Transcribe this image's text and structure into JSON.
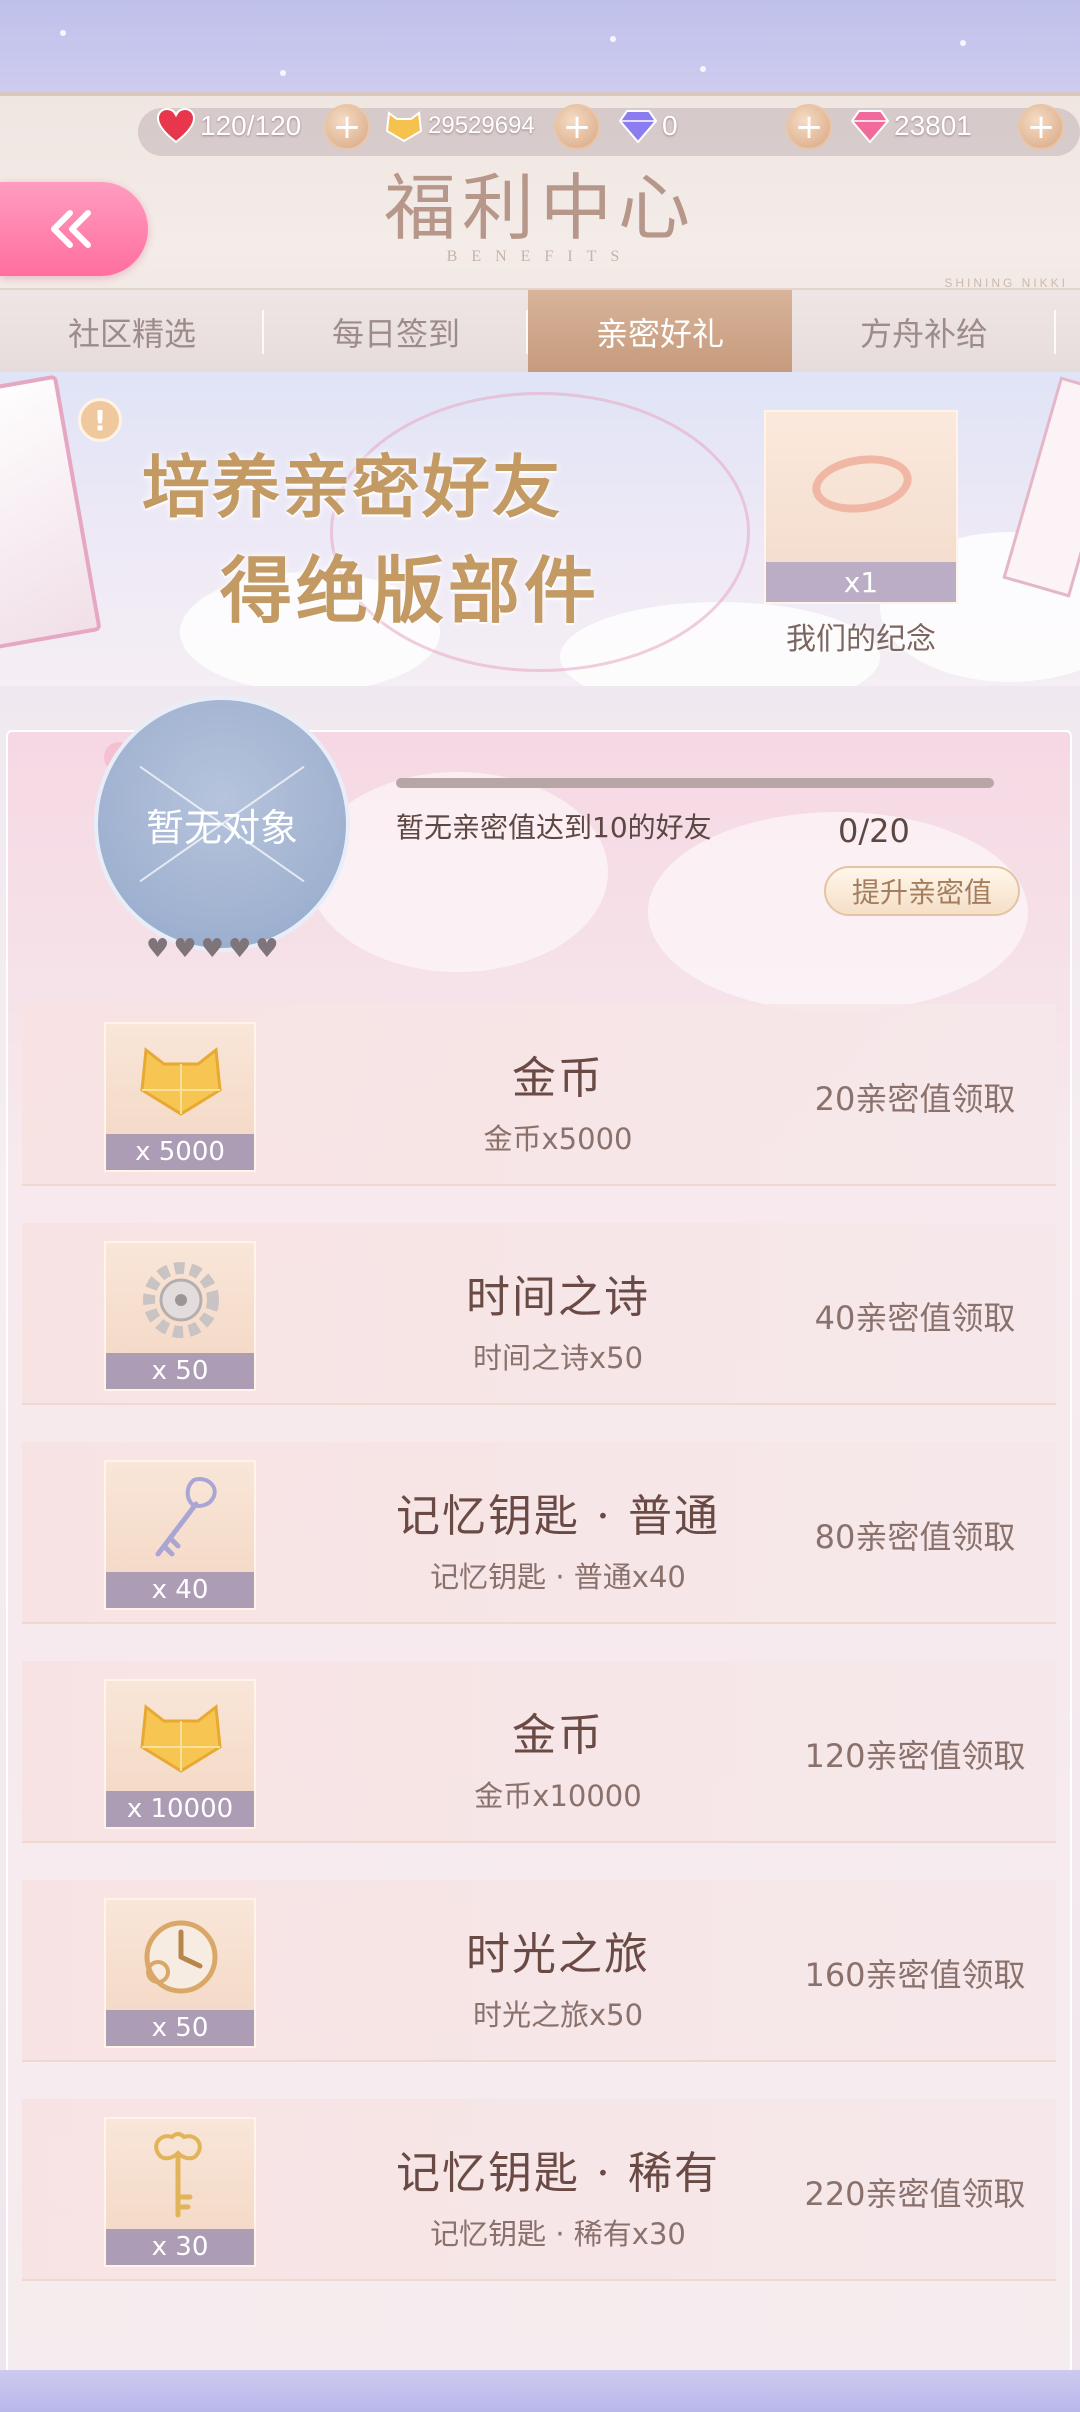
{
  "resources": {
    "stamina": "120/120",
    "gold": "29529694",
    "diamond": "0",
    "pink_diamond": "23801"
  },
  "header": {
    "title": "福利中心",
    "subtitle": "BENEFITS",
    "side_text": "SHINING NIKKI"
  },
  "tabs": [
    {
      "label": "社区精选",
      "active": false
    },
    {
      "label": "每日签到",
      "active": false
    },
    {
      "label": "亲密好礼",
      "active": true
    },
    {
      "label": "方舟补给",
      "active": false
    }
  ],
  "banner": {
    "line1": "培养亲密好友",
    "line2": "得绝版部件",
    "reward_qty": "x1",
    "reward_name": "我们的纪念"
  },
  "friend": {
    "avatar_text": "暂无对象",
    "progress_label": "暂无亲密值达到10的好友",
    "progress_count": "0/20",
    "progress_fraction": 0,
    "boost_button": "提升亲密值",
    "hearts": 5
  },
  "rewards": [
    {
      "name": "金币",
      "desc": "金币x5000",
      "qty": "x 5000",
      "claim": "20亲密值领取",
      "icon": "gold-cat-icon"
    },
    {
      "name": "时间之诗",
      "desc": "时间之诗x50",
      "qty": "x 50",
      "claim": "40亲密值领取",
      "icon": "gear-icon"
    },
    {
      "name": "记忆钥匙 · 普通",
      "desc": "记忆钥匙 · 普通x40",
      "qty": "x 40",
      "claim": "80亲密值领取",
      "icon": "silver-key-icon"
    },
    {
      "name": "金币",
      "desc": "金币x10000",
      "qty": "x 10000",
      "claim": "120亲密值领取",
      "icon": "gold-cat-icon"
    },
    {
      "name": "时光之旅",
      "desc": "时光之旅x50",
      "qty": "x 50",
      "claim": "160亲密值领取",
      "icon": "clock-icon"
    },
    {
      "name": "记忆钥匙 · 稀有",
      "desc": "记忆钥匙 · 稀有x30",
      "qty": "x 30",
      "claim": "220亲密值领取",
      "icon": "gold-key-icon"
    }
  ],
  "colors": {
    "accent_pink": "#ff6f9e",
    "tab_active": "#c69a7c",
    "gold_text": "#c39a63"
  }
}
